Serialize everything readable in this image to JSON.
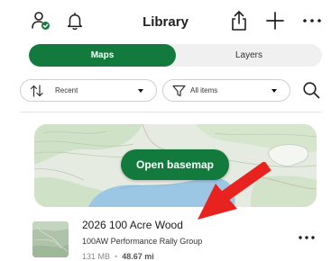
{
  "header": {
    "title": "Library",
    "icons": {
      "account": "account-check-icon",
      "notifications": "bell-icon",
      "share": "share-icon",
      "add": "plus-icon",
      "more": "more-horizontal-icon"
    }
  },
  "tabs": [
    {
      "label": "Maps",
      "selected": true
    },
    {
      "label": "Layers",
      "selected": false
    }
  ],
  "filters": {
    "sort": {
      "label": "Recent",
      "icon": "sort-arrows-icon"
    },
    "type": {
      "label": "All items",
      "icon": "filter-funnel-icon"
    },
    "search_icon": "search-icon"
  },
  "basemap": {
    "button_label": "Open basemap"
  },
  "maps": [
    {
      "title": "2026 100 Acre Wood",
      "subtitle": "100AW Performance Rally Group",
      "size": "131 MB",
      "distance": "48.67 mi"
    }
  ],
  "colors": {
    "accent": "#137a3d",
    "arrow": "#e8231f"
  }
}
